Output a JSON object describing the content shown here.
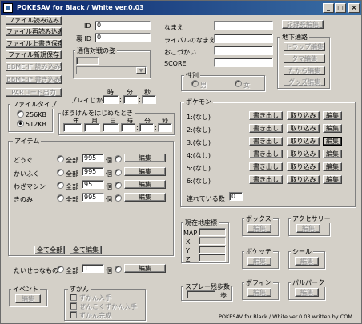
{
  "title": "POKESAV for Black / White ver.0.03",
  "window_buttons": {
    "minimize": "_",
    "maximize": "□",
    "close": "×"
  },
  "file_buttons": [
    "ファイル読み込み",
    "ファイル再読み込み",
    "ファイル上書き保存",
    "ファイル新規保存",
    "BBME-IF 読み込み",
    "BBME-IF 書き込み",
    "PARコード出力"
  ],
  "ids": {
    "id_label": "ID",
    "id_value": "0",
    "ura_label": "裏 ID",
    "ura_value": "0"
  },
  "comm": {
    "label": "通信対戦の姿"
  },
  "playtime": {
    "label": "プレイじかん",
    "hour": "時",
    "min": "分",
    "sec": "秒"
  },
  "filetype": {
    "label": "ファイルタイプ",
    "opt1": "256KB",
    "opt2": "512KB"
  },
  "start": {
    "label": "ぼうけんをはじめたとき",
    "year": "年",
    "month": "月",
    "day": "日",
    "hour": "時",
    "min": "分",
    "sec": "秒"
  },
  "items": {
    "label": "アイテム",
    "rows": [
      {
        "name": "どうぐ",
        "all": "全部",
        "count": "995",
        "unit": "個",
        "edit": "編集"
      },
      {
        "name": "かいふく",
        "all": "全部",
        "count": "995",
        "unit": "個",
        "edit": "編集"
      },
      {
        "name": "わざマシン",
        "all": "全部",
        "count": "95",
        "unit": "個",
        "edit": "編集"
      },
      {
        "name": "きのみ",
        "all": "全部",
        "count": "995",
        "unit": "個",
        "edit": "編集"
      }
    ],
    "all_all": "全て全部",
    "all_edit": "全て編集",
    "important": {
      "name": "たいせつなもの",
      "all": "全部",
      "count": "1",
      "unit": "個",
      "edit": "編集"
    }
  },
  "event": {
    "label": "イベント",
    "edit": "編集"
  },
  "zukan": {
    "label": "ずかん",
    "c1": "ずかん入手",
    "c2": "ぜんこくずかん入手",
    "c3": "ずかん完成"
  },
  "trainer": {
    "name": "なまえ",
    "rival": "ライバルのなまえ",
    "money": "おこづかい",
    "score": "SCORE",
    "record_btn": "記録系編集"
  },
  "chika": {
    "label": "地下通路",
    "btns": [
      "トラップ編集",
      "タマ編集",
      "たから編集",
      "グッズ編集"
    ]
  },
  "gender": {
    "label": "性別",
    "male": "男",
    "female": "女"
  },
  "pokemon": {
    "label": "ポケモン",
    "slots": [
      {
        "label": "1:(なし)"
      },
      {
        "label": "2:(なし)"
      },
      {
        "label": "3:(なし)"
      },
      {
        "label": "4:(なし)"
      },
      {
        "label": "5:(なし)"
      },
      {
        "label": "6:(なし)"
      }
    ],
    "write": "書き出し",
    "read": "取り込み",
    "edit": "編集",
    "party_label": "連れている数",
    "party_count": "0"
  },
  "location": {
    "label": "現在地座標",
    "map": "MAP",
    "x": "X",
    "y": "Y",
    "z": "Z"
  },
  "box": {
    "label": "ボックス",
    "edit": "編集"
  },
  "accessory": {
    "label": "アクセサリー",
    "edit": "編集"
  },
  "poketch": {
    "label": "ポケッチ",
    "edit": "編集"
  },
  "seal": {
    "label": "シール",
    "edit": "編集"
  },
  "poffin": {
    "label": "ポフィン",
    "edit": "編集"
  },
  "palpark": {
    "label": "パルパーク",
    "edit": "編集"
  },
  "spray": {
    "label": "スプレー残歩数",
    "unit": "歩"
  },
  "footer": "POKESAV for Black / White ver.0.03 written by COM",
  "colors": {
    "title_start": "#0a246a",
    "title_end": "#3a6ea5",
    "face": "#d4d0c8"
  }
}
